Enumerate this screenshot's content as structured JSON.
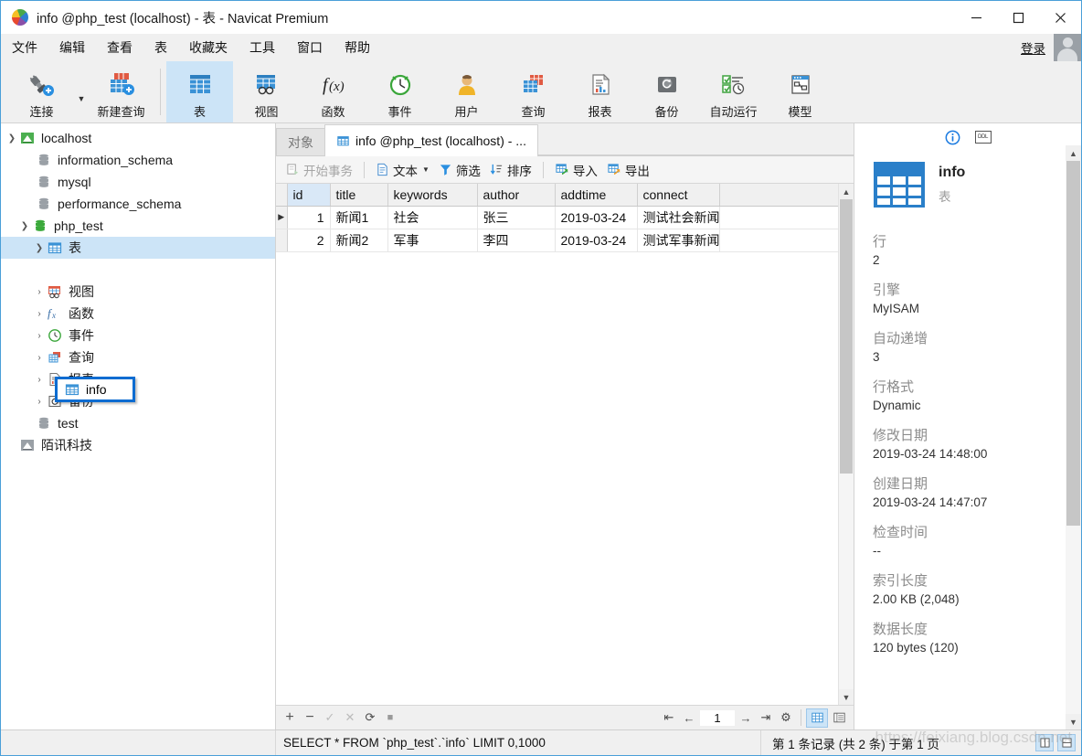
{
  "window": {
    "title": "info @php_test (localhost) - 表 - Navicat Premium",
    "minimize": "—",
    "maximize": "☐",
    "close": "✕"
  },
  "menubar": {
    "items": [
      "文件",
      "编辑",
      "查看",
      "表",
      "收藏夹",
      "工具",
      "窗口",
      "帮助"
    ],
    "login_label": "登录"
  },
  "toolbar": {
    "groups": [
      {
        "buttons": [
          {
            "label": "连接",
            "icon": "connection-icon",
            "active": false,
            "caret": true
          },
          {
            "label": "新建查询",
            "icon": "new-query-icon",
            "active": false,
            "caret": false
          }
        ]
      },
      {
        "buttons": [
          {
            "label": "表",
            "icon": "table-icon",
            "active": true,
            "caret": false
          },
          {
            "label": "视图",
            "icon": "view-icon",
            "active": false,
            "caret": false
          },
          {
            "label": "函数",
            "icon": "function-icon",
            "active": false,
            "caret": false
          },
          {
            "label": "事件",
            "icon": "event-icon",
            "active": false,
            "caret": false
          },
          {
            "label": "用户",
            "icon": "user-icon",
            "active": false,
            "caret": false
          },
          {
            "label": "查询",
            "icon": "query-icon",
            "active": false,
            "caret": false
          },
          {
            "label": "报表",
            "icon": "report-icon",
            "active": false,
            "caret": false
          },
          {
            "label": "备份",
            "icon": "backup-icon",
            "active": false,
            "caret": false
          },
          {
            "label": "自动运行",
            "icon": "automation-icon",
            "active": false,
            "caret": false
          },
          {
            "label": "模型",
            "icon": "model-icon",
            "active": false,
            "caret": false
          }
        ]
      }
    ]
  },
  "sidebar": {
    "nodes": [
      {
        "label": "localhost",
        "indent": 0,
        "twist": "open",
        "icon": "connection-green-icon",
        "selected": false
      },
      {
        "label": "information_schema",
        "indent": 1,
        "twist": "none",
        "icon": "database-grey-icon",
        "selected": false
      },
      {
        "label": "mysql",
        "indent": 1,
        "twist": "none",
        "icon": "database-grey-icon",
        "selected": false
      },
      {
        "label": "performance_schema",
        "indent": 1,
        "twist": "none",
        "icon": "database-grey-icon",
        "selected": false
      },
      {
        "label": "php_test",
        "indent": 1,
        "twist": "open",
        "icon": "database-green-icon",
        "selected": false
      },
      {
        "label": "表",
        "indent": 2,
        "twist": "open",
        "icon": "table-icon",
        "selected": true
      },
      {
        "label": "info",
        "indent": 3,
        "twist": "none",
        "icon": "table-icon",
        "selected": false
      },
      {
        "label": "视图",
        "indent": 2,
        "twist": "closed",
        "icon": "view-icon",
        "selected": false
      },
      {
        "label": "函数",
        "indent": 2,
        "twist": "closed",
        "icon": "function-icon",
        "selected": false
      },
      {
        "label": "事件",
        "indent": 2,
        "twist": "closed",
        "icon": "event-icon",
        "selected": false
      },
      {
        "label": "查询",
        "indent": 2,
        "twist": "closed",
        "icon": "query-icon",
        "selected": false
      },
      {
        "label": "报表",
        "indent": 2,
        "twist": "closed",
        "icon": "report-icon",
        "selected": false
      },
      {
        "label": "备份",
        "indent": 2,
        "twist": "closed",
        "icon": "backup-icon",
        "selected": false
      },
      {
        "label": "test",
        "indent": 1,
        "twist": "none",
        "icon": "database-grey-icon",
        "selected": false
      },
      {
        "label": "陌讯科技",
        "indent": 0,
        "twist": "none",
        "icon": "connection-grey-icon",
        "selected": false
      }
    ],
    "highlighted_node": "info"
  },
  "tabs": {
    "object_tab": "对象",
    "active_tab": "info @php_test (localhost) - ..."
  },
  "grid_toolbar": {
    "begin_transaction": "开始事务",
    "text": "文本",
    "filter": "筛选",
    "sort": "排序",
    "import": "导入",
    "export": "导出"
  },
  "grid": {
    "columns": [
      "id",
      "title",
      "keywords",
      "author",
      "addtime",
      "connect"
    ],
    "rows": [
      {
        "marker": "▶",
        "id": "1",
        "title": "新闻1",
        "keywords": "社会",
        "author": "张三",
        "addtime": "2019-03-24",
        "connect": "测试社会新闻"
      },
      {
        "marker": "",
        "id": "2",
        "title": "新闻2",
        "keywords": "军事",
        "author": "李四",
        "addtime": "2019-03-24",
        "connect": "测试军事新闻"
      }
    ]
  },
  "grid_nav": {
    "add": "+",
    "remove": "−",
    "confirm": "✓",
    "cancel": "✕",
    "refresh": "⟳",
    "stop": "■",
    "first": "⇤",
    "prev": "←",
    "page": "1",
    "next": "→",
    "last": "⇥",
    "settings": "⚙"
  },
  "info_panel": {
    "tab_info_icon": "info-circle-icon",
    "ddl_label": "DDL",
    "object_name": "info",
    "object_kind": "表",
    "fields": [
      {
        "label": "行",
        "value": "2"
      },
      {
        "label": "引擎",
        "value": "MyISAM"
      },
      {
        "label": "自动递增",
        "value": "3"
      },
      {
        "label": "行格式",
        "value": "Dynamic"
      },
      {
        "label": "修改日期",
        "value": "2019-03-24 14:48:00"
      },
      {
        "label": "创建日期",
        "value": "2019-03-24 14:47:07"
      },
      {
        "label": "检查时间",
        "value": "--"
      },
      {
        "label": "索引长度",
        "value": "2.00 KB (2,048)"
      },
      {
        "label": "数据长度",
        "value": "120 bytes (120)"
      }
    ]
  },
  "statusbar": {
    "sql": "SELECT * FROM `php_test`.`info` LIMIT 0,1000",
    "record_info": "第 1 条记录 (共 2 条) 于第 1 页",
    "watermark": "https://feixiang.blog.csdn.net"
  },
  "colors": {
    "accent": "#0c6cd1",
    "selection": "#cce4f7",
    "toolbar_bg": "#f0f0f0",
    "border": "#d3d3d3",
    "green": "#3ba93b",
    "blue_icon": "#2a7fc9"
  }
}
